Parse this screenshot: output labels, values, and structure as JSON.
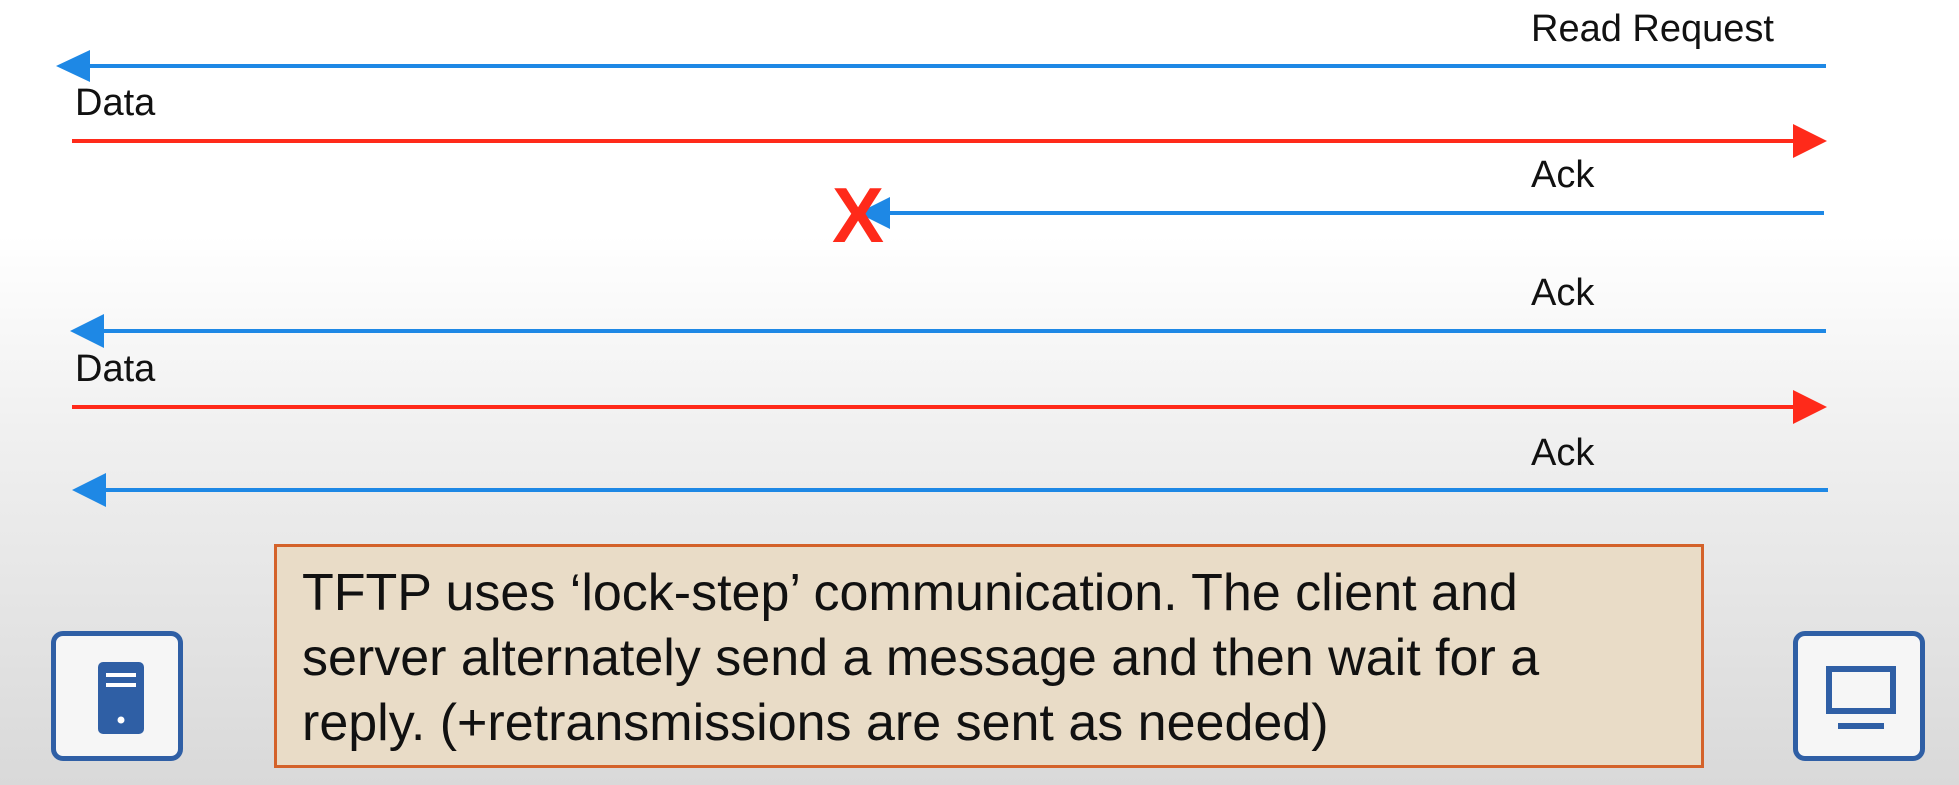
{
  "colors": {
    "server_to_client": "#1e88e5",
    "client_to_server": "#ff2a1a",
    "note_border": "#d4622a",
    "device_border": "#2f5fa5"
  },
  "messages": [
    {
      "label": "Read Request",
      "direction": "to-left",
      "lost": false
    },
    {
      "label": "Data",
      "direction": "to-right",
      "lost": false
    },
    {
      "label": "Ack",
      "direction": "to-left",
      "lost": true
    },
    {
      "label": "Ack",
      "direction": "to-left",
      "lost": false
    },
    {
      "label": "Data",
      "direction": "to-right",
      "lost": false
    },
    {
      "label": "Ack",
      "direction": "to-left",
      "lost": false
    }
  ],
  "lost_marker": "X",
  "note": {
    "line1": "TFTP uses ‘lock-step’ communication.  The client and",
    "line2": "server alternately send a message and then wait for a",
    "line3": "reply.  (+retransmissions are sent as needed)"
  },
  "icons": {
    "left": "server-icon",
    "right": "monitor-icon"
  }
}
